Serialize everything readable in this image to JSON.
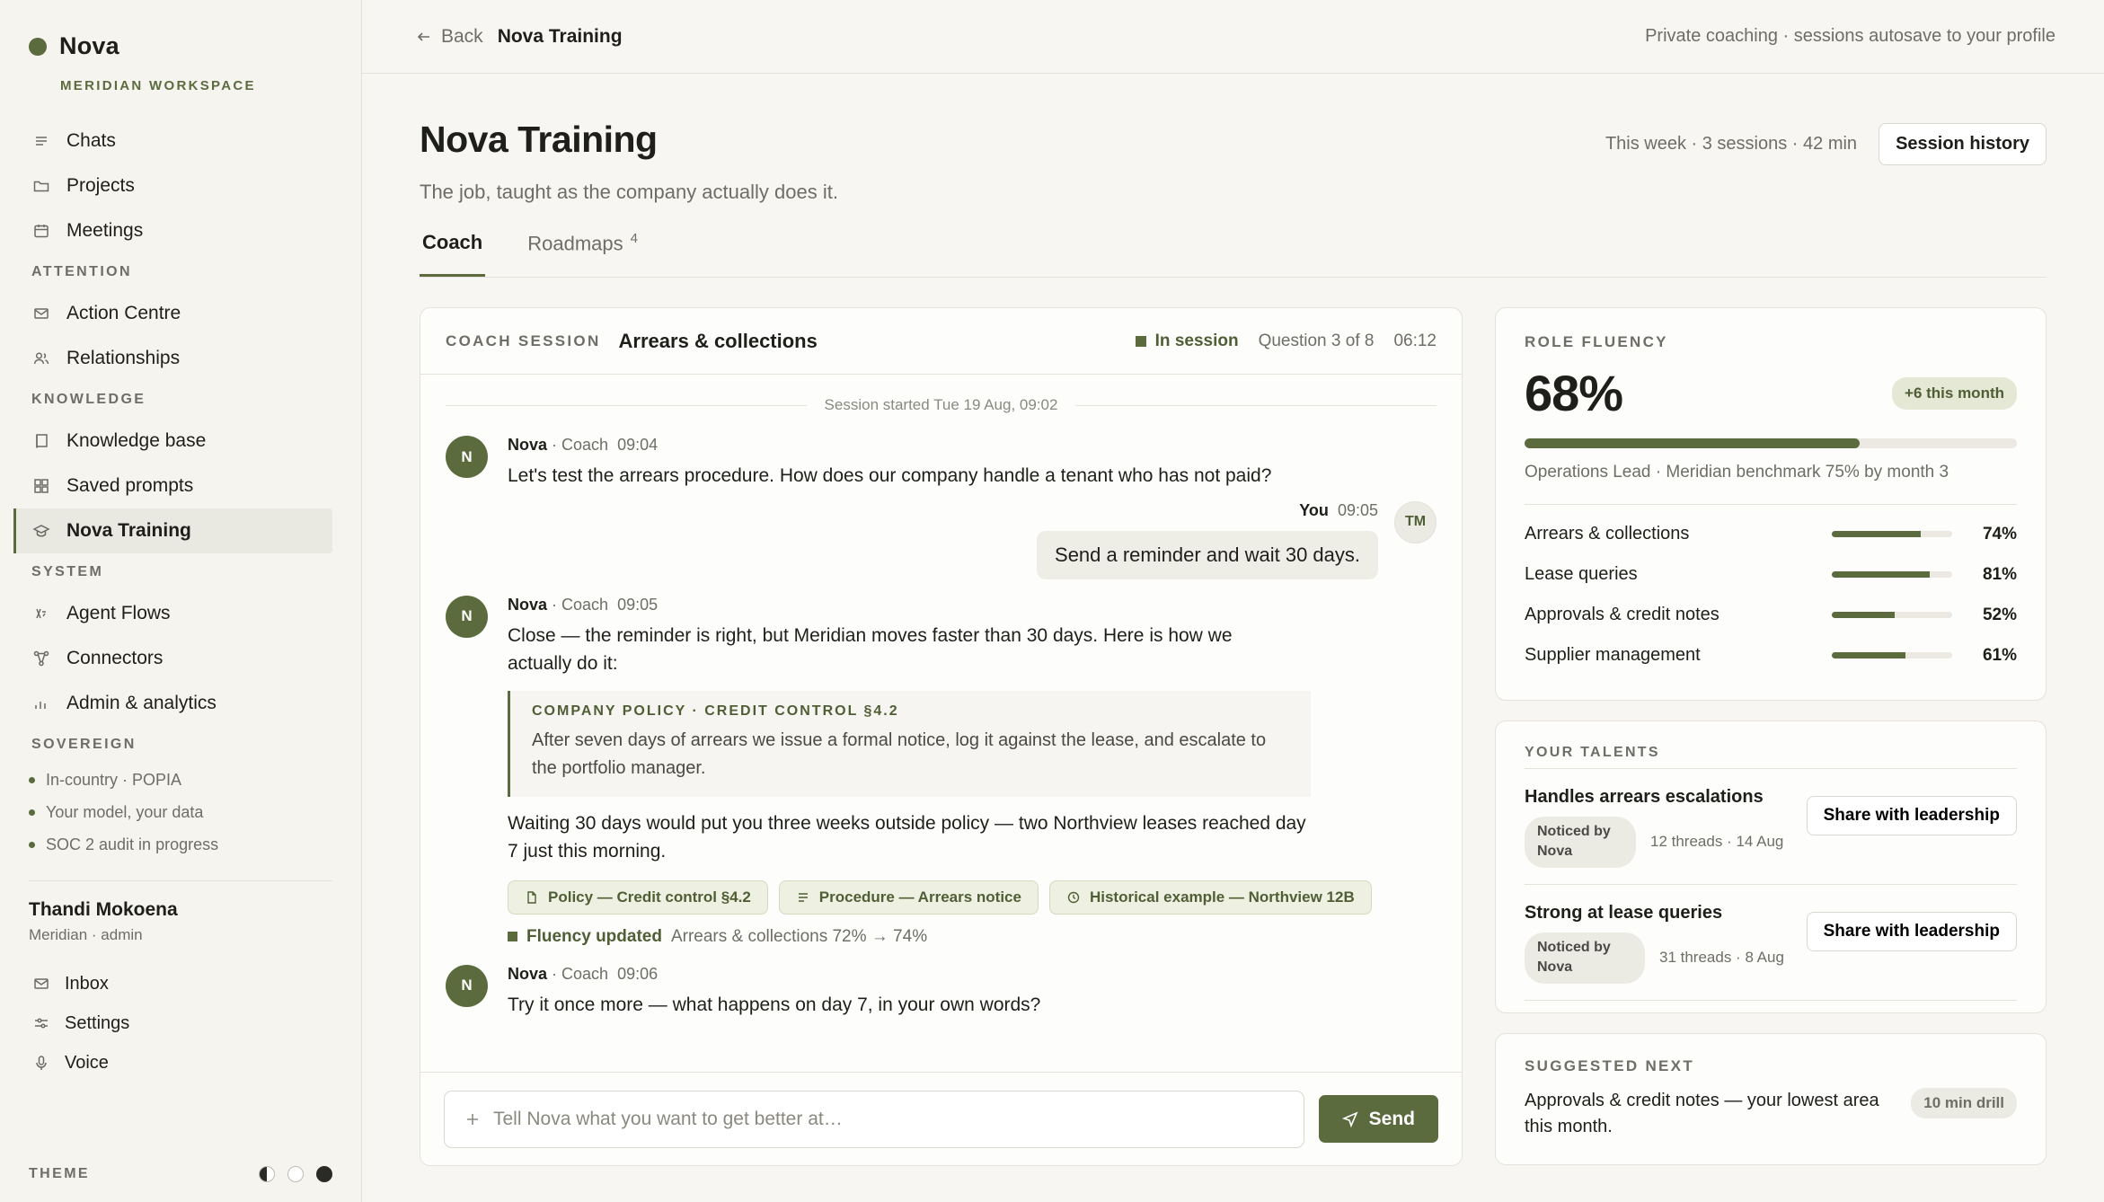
{
  "brand": {
    "name": "Nova",
    "workspace": "MERIDIAN WORKSPACE"
  },
  "nav": {
    "main": [
      {
        "label": "Chats",
        "icon": "menu-lines-icon"
      },
      {
        "label": "Projects",
        "icon": "folder-icon"
      },
      {
        "label": "Meetings",
        "icon": "calendar-icon"
      }
    ],
    "attention_label": "ATTENTION",
    "attention": [
      {
        "label": "Action Centre",
        "icon": "mail-icon"
      },
      {
        "label": "Relationships",
        "icon": "users-icon"
      }
    ],
    "knowledge_label": "KNOWLEDGE",
    "knowledge": [
      {
        "label": "Knowledge base",
        "icon": "book-icon"
      },
      {
        "label": "Saved prompts",
        "icon": "grid-icon"
      },
      {
        "label": "Nova Training",
        "icon": "graduation-cap-icon"
      }
    ],
    "system_label": "SYSTEM",
    "system": [
      {
        "label": "Agent Flows",
        "icon": "function-icon"
      },
      {
        "label": "Connectors",
        "icon": "network-icon"
      },
      {
        "label": "Admin & analytics",
        "icon": "bar-chart-icon"
      }
    ],
    "sovereign_label": "SOVEREIGN",
    "sovereign": [
      "In-country · POPIA",
      "Your model, your data",
      "SOC 2 audit in progress"
    ]
  },
  "user": {
    "name": "Thandi Mokoena",
    "sub": "Meridian · admin"
  },
  "user_nav": [
    {
      "label": "Inbox",
      "icon": "mail-icon"
    },
    {
      "label": "Settings",
      "icon": "sliders-icon"
    },
    {
      "label": "Voice",
      "icon": "microphone-icon"
    }
  ],
  "theme_label": "THEME",
  "topbar": {
    "back": "Back",
    "crumb": "Nova Training",
    "note": "Private coaching · sessions autosave to your profile"
  },
  "page": {
    "title": "Nova Training",
    "subtitle": "The job, taught as the company actually does it.",
    "week": "This week · 3 sessions · 42 min",
    "history_button": "Session history",
    "tabs": [
      {
        "label": "Coach",
        "badge": ""
      },
      {
        "label": "Roadmaps",
        "badge": "4"
      }
    ]
  },
  "coach": {
    "label": "COACH SESSION",
    "topic": "Arrears & collections",
    "status": "In session",
    "progress": "Question 3 of 8",
    "timer": "06:12",
    "started": "Session started Tue 19 Aug, 09:02",
    "messages": {
      "m1": {
        "initial": "N",
        "author": "Nova",
        "role": " · Coach",
        "time": "09:04",
        "text": "Let's test the arrears procedure. How does our company handle a tenant who has not paid?"
      },
      "m2": {
        "initial": "TM",
        "author": "You",
        "time": "09:05",
        "text": "Send a reminder and wait 30 days."
      },
      "m3": {
        "initial": "N",
        "author": "Nova",
        "role": " · Coach",
        "time": "09:05",
        "text": "Close — the reminder is right, but Meridian moves faster than 30 days. Here is how we actually do it:",
        "policy_head": "COMPANY POLICY · CREDIT CONTROL §4.2",
        "policy_text": "After seven days of arrears we issue a formal notice, log it against the lease, and escalate to the portfolio manager.",
        "followup": "Waiting 30 days would put you three weeks outside policy — two Northview leases reached day 7 just this morning.",
        "chips": [
          {
            "label": "Policy — Credit control §4.2",
            "icon": "document-icon"
          },
          {
            "label": "Procedure — Arrears notice",
            "icon": "list-icon"
          },
          {
            "label": "Historical example — Northview 12B",
            "icon": "clock-icon"
          }
        ],
        "fluency_label": "Fluency updated",
        "fluency_text": "Arrears & collections 72% → 74%"
      },
      "m4": {
        "initial": "N",
        "author": "Nova",
        "role": " · Coach",
        "time": "09:06",
        "text": "Try it once more — what happens on day 7, in your own words?"
      }
    },
    "composer_placeholder": "Tell Nova what you want to get better at…",
    "send": "Send"
  },
  "fluency": {
    "label": "ROLE FLUENCY",
    "value": "68%",
    "value_num": 68,
    "delta": "+6 this month",
    "benchmark": "Operations Lead · Meridian benchmark 75% by month 3",
    "skills": [
      {
        "name": "Arrears & collections",
        "pct": "74%",
        "value": 74
      },
      {
        "name": "Lease queries",
        "pct": "81%",
        "value": 81
      },
      {
        "name": "Approvals & credit notes",
        "pct": "52%",
        "value": 52
      },
      {
        "name": "Supplier management",
        "pct": "61%",
        "value": 61
      }
    ]
  },
  "talents": {
    "label": "YOUR TALENTS",
    "items": [
      {
        "name": "Handles arrears escalations",
        "badge": "Noticed by Nova",
        "meta": "12 threads · 14 Aug",
        "action": "Share with leadership"
      },
      {
        "name": "Strong at lease queries",
        "badge": "Noticed by Nova",
        "meta": "31 threads · 8 Aug",
        "action": "Share with leadership"
      }
    ]
  },
  "suggested": {
    "label": "SUGGESTED NEXT",
    "text": "Approvals & credit notes — your lowest area this month.",
    "badge": "10 min drill"
  },
  "colors": {
    "accent": "#5b6b3e",
    "background": "#f7f6f2"
  }
}
